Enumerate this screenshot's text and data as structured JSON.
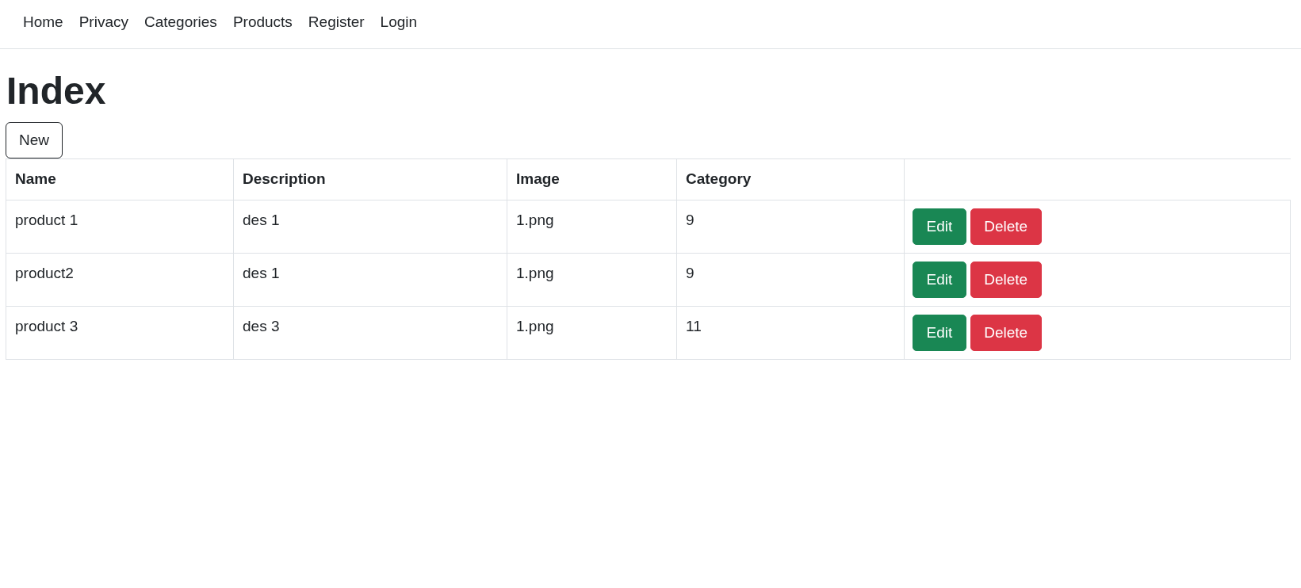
{
  "nav": {
    "links": [
      "Home",
      "Privacy",
      "Categories",
      "Products",
      "Register",
      "Login"
    ]
  },
  "heading": "Index",
  "new_button": "New",
  "table": {
    "columns": [
      "Name",
      "Description",
      "Image",
      "Category"
    ],
    "rows": [
      {
        "cells": [
          "product 1",
          "des 1",
          "1.png",
          "9"
        ],
        "actions": [
          {
            "kind": "edit",
            "label": "Edit"
          },
          {
            "kind": "delete",
            "label": "Delete"
          }
        ]
      },
      {
        "cells": [
          "product2",
          "des 1",
          "1.png",
          "9"
        ],
        "actions": [
          {
            "kind": "edit",
            "label": "Edit"
          },
          {
            "kind": "delete",
            "label": "Delete"
          }
        ]
      },
      {
        "cells": [
          "product 3",
          "des 3",
          "1.png",
          "11"
        ],
        "actions": [
          {
            "kind": "edit",
            "label": "Edit"
          },
          {
            "kind": "delete",
            "label": "Delete"
          }
        ]
      }
    ]
  }
}
